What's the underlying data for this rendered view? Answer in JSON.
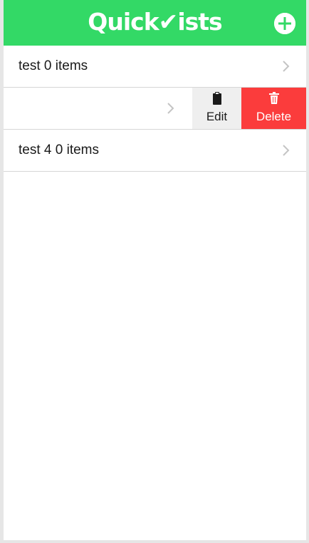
{
  "app": {
    "title": "Quick✔ists",
    "brand_color": "#33d966"
  },
  "navbar": {
    "add_icon": "plus-circle-icon"
  },
  "lists": [
    {
      "label": "test 0 items",
      "chevron_icon": "chevron-right-icon"
    },
    {
      "label": "",
      "chevron_icon": "chevron-right-icon",
      "swiped": true
    },
    {
      "label": "test 4 0 items",
      "chevron_icon": "chevron-right-icon"
    }
  ],
  "swipe_actions": {
    "edit": {
      "label": "Edit",
      "icon": "clipboard-icon",
      "color": "#efefef"
    },
    "delete": {
      "label": "Delete",
      "icon": "trash-icon",
      "color": "#fb3c3c"
    }
  }
}
